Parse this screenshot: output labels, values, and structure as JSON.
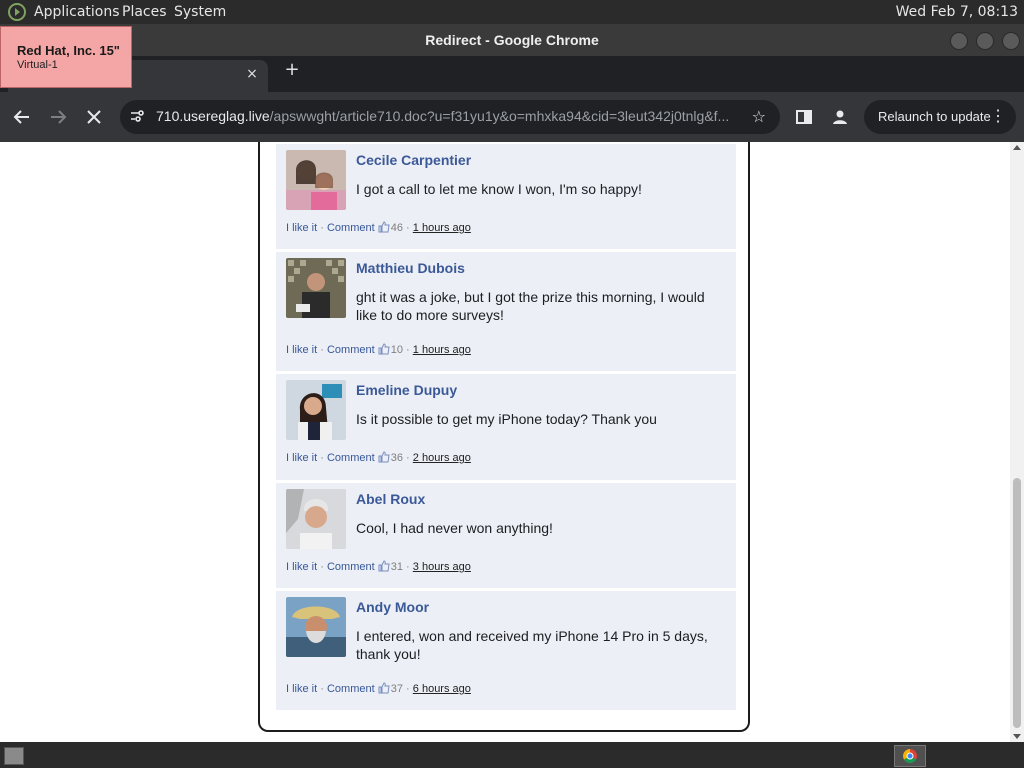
{
  "panel": {
    "menus": [
      "Applications",
      "Places",
      "System"
    ],
    "clock": "Wed Feb  7, 08:13"
  },
  "tooltip": {
    "line1": "Red Hat, Inc. 15\"",
    "line2": "Virtual-1"
  },
  "window": {
    "title": "Redirect - Google Chrome"
  },
  "tab": {
    "close_glyph": "×",
    "new_tab_glyph": "+"
  },
  "toolbar": {
    "url_host": "710.usereglag.live",
    "url_path": "/apswwght/article710.doc?u=f31yu1y&o=mhxka94&cid=3leut342j0tnlg&f...",
    "relaunch_label": "Relaunch to update"
  },
  "comments": [
    {
      "name": "Cecile Carpentier",
      "text": "I got a call to let me know I won, I'm so happy!",
      "like": "I like it",
      "comment": "Comment",
      "count": "46",
      "time": "1 hours ago"
    },
    {
      "name": "Matthieu Dubois",
      "text": "ght it was a joke, but I got the prize this morning, I would like to do more surveys!",
      "like": "I like it",
      "comment": "Comment",
      "count": "10",
      "time": "1 hours ago"
    },
    {
      "name": "Emeline Dupuy",
      "text": "Is it possible to get my iPhone today? Thank you",
      "like": "I like it",
      "comment": "Comment",
      "count": "36",
      "time": "2 hours ago"
    },
    {
      "name": "Abel Roux",
      "text": "Cool, I had never won anything!",
      "like": "I like it",
      "comment": "Comment",
      "count": "31",
      "time": "3 hours ago"
    },
    {
      "name": "Andy Moor",
      "text": "I entered, won and received my iPhone 14 Pro in 5 days, thank you!",
      "like": "I like it",
      "comment": "Comment",
      "count": "37",
      "time": "6 hours ago"
    }
  ],
  "colors": {
    "accent_link": "#3b5998",
    "comment_bg": "#eceff5",
    "tooltip_bg": "#f4a5a5"
  }
}
